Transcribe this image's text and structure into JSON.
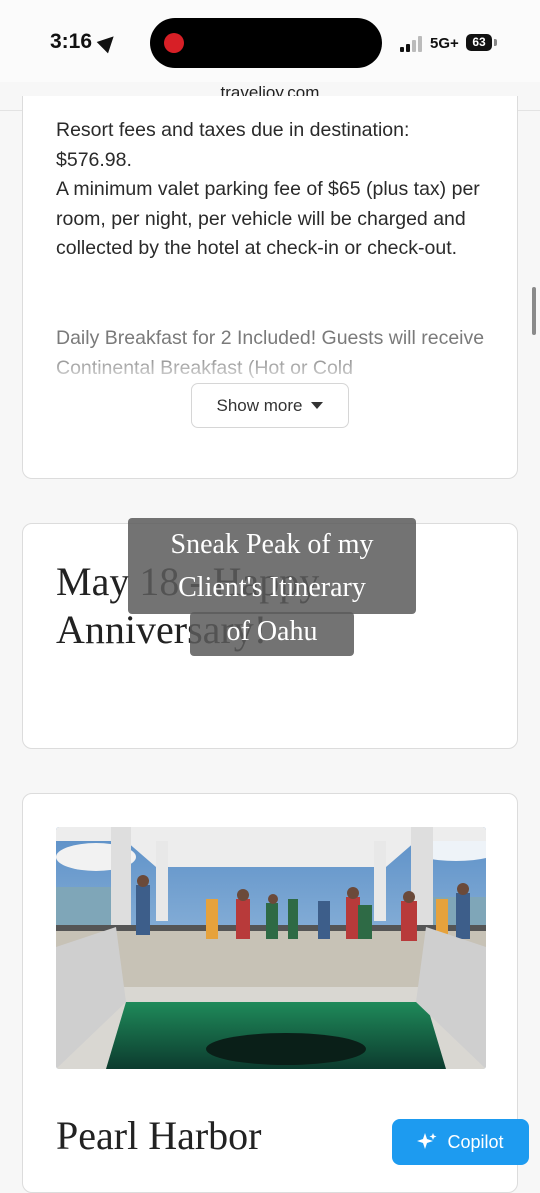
{
  "status_bar": {
    "time": "3:16",
    "network": "5G+",
    "battery": "63"
  },
  "browser": {
    "url": "traveljoy.com"
  },
  "hotel_card": {
    "fees_lines": [
      "Resort fees and taxes due in destination: $576.98.",
      "A minimum valet parking fee of $65 (plus tax) per room, per night, per vehicle will be charged and collected by the hotel at check-in or check-out."
    ],
    "breakfast_text": "Daily Breakfast for 2 Included! Guests will receive Continental Breakfast (Hot or Cold",
    "show_more_label": "Show more"
  },
  "day_card": {
    "title": "May 18 - Happy Anniversary!"
  },
  "overlay_caption": {
    "line1": "Sneak Peak of my Client's Itinerary",
    "line2": "of Oahu"
  },
  "place_card": {
    "title": "Pearl Harbor"
  },
  "copilot": {
    "label": "Copilot"
  }
}
